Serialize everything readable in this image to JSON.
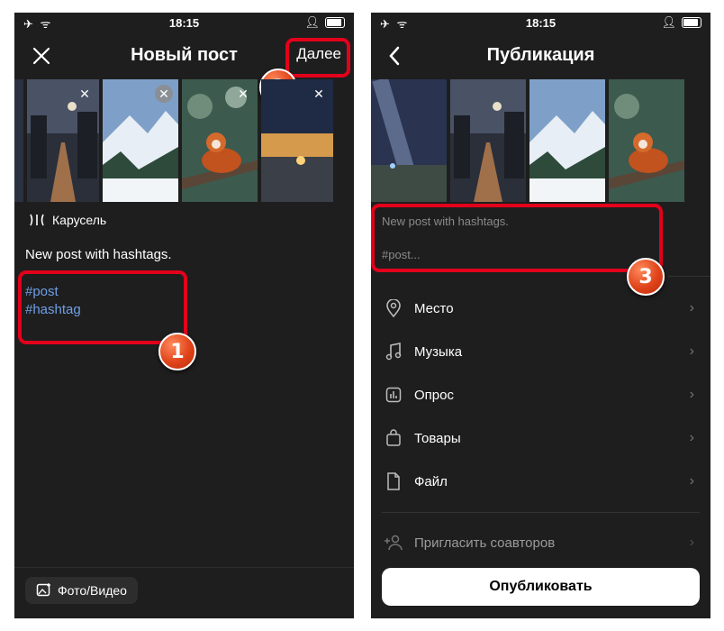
{
  "status": {
    "time": "18:15"
  },
  "left": {
    "title": "Новый пост",
    "next_label": "Далее",
    "carousel_label": "Карусель",
    "post_text": "New post with hashtags.",
    "hashtags": [
      "#post",
      "#hashtag"
    ],
    "media_button": "Фото/Видео",
    "markers": [
      "1",
      "2"
    ]
  },
  "right": {
    "title": "Публикация",
    "preview_text": "New post with hashtags.",
    "preview_tags": "#post...",
    "menu": [
      {
        "label": "Место",
        "icon": "location-pin-icon"
      },
      {
        "label": "Музыка",
        "icon": "music-note-icon"
      },
      {
        "label": "Опрос",
        "icon": "poll-icon"
      },
      {
        "label": "Товары",
        "icon": "shopping-bag-icon"
      },
      {
        "label": "Файл",
        "icon": "file-icon"
      }
    ],
    "invite_label": "Пригласить соавторов",
    "publish_label": "Опубликовать",
    "marker": "3"
  },
  "colors": {
    "accent_red": "#e2001a",
    "hashtag_blue": "#6f9fe6",
    "background": "#1e1e1e"
  }
}
